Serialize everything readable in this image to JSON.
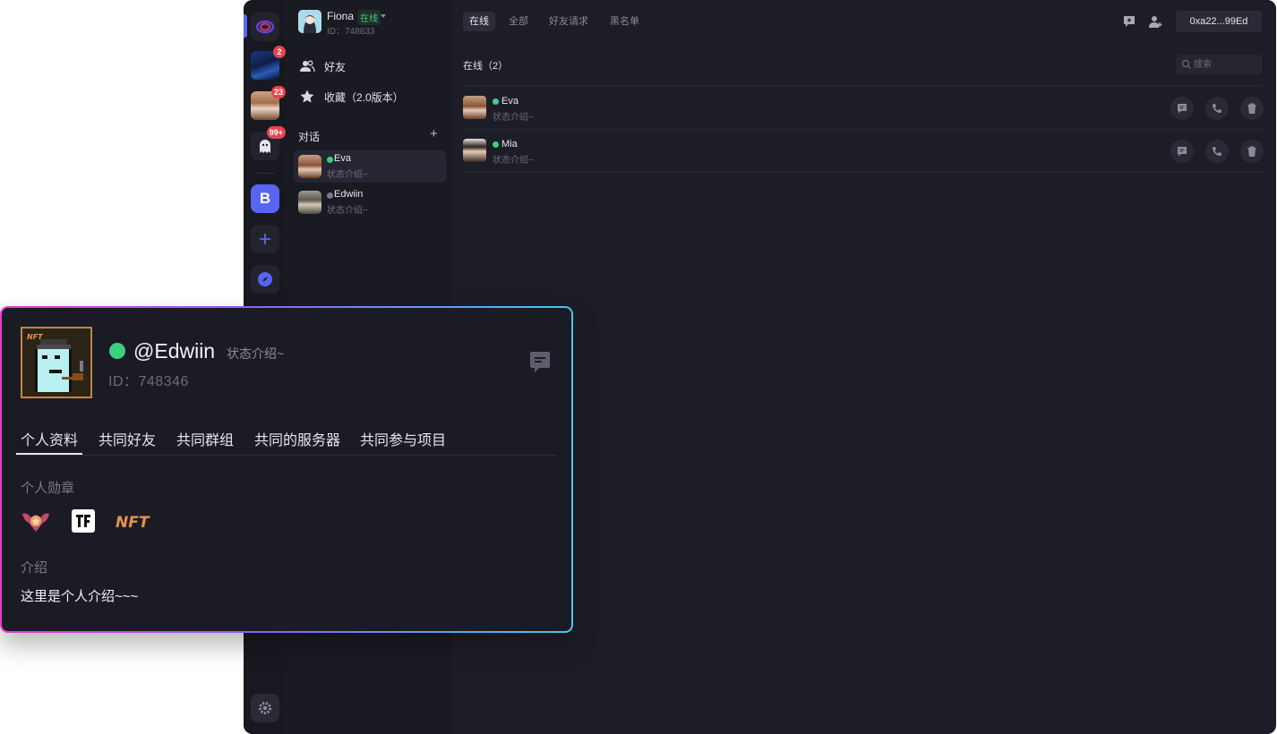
{
  "header": {
    "user_name": "Fiona",
    "status": "在线",
    "user_id": "ID：748833"
  },
  "rail": {
    "badges": [
      "2",
      "23",
      "99+"
    ],
    "server_letter": "B"
  },
  "sidebar": {
    "items": [
      {
        "label": "好友",
        "icon": "friends-icon"
      },
      {
        "label": "收藏（2.0版本）",
        "icon": "star-icon"
      }
    ],
    "section_title": "对话",
    "add_symbol": "+",
    "conversations": [
      {
        "name": "Eva",
        "sub": "状态介绍~",
        "online": true
      },
      {
        "name": "Edwiin",
        "sub": "状态介绍~",
        "online": false
      }
    ]
  },
  "topbar": {
    "tabs": [
      "在线",
      "全部",
      "好友请求",
      "黑名单"
    ],
    "wallet": "0xa22...99Ed"
  },
  "main": {
    "list_title": "在线（2）",
    "search_placeholder": "搜索",
    "friends": [
      {
        "name": "Eva",
        "sub": "状态介绍~"
      },
      {
        "name": "Mia",
        "sub": "状态介绍~"
      }
    ]
  },
  "profile_card": {
    "name": "@Edwiin",
    "status": "状态介绍~",
    "id": "ID：748346",
    "tabs": [
      "个人资料",
      "共同好友",
      "共同群组",
      "共同的服务器",
      "共同参与项目"
    ],
    "badges_title": "个人勋章",
    "intro_title": "介绍",
    "intro": "这里是个人介绍~~~",
    "nft_label": "NFT"
  },
  "colors": {
    "accent": "#5865f2",
    "online": "#3bd080",
    "badge": "#e8454f",
    "card_gradient": [
      "#e53fc8",
      "#8f5cf0",
      "#48c6ef"
    ]
  }
}
